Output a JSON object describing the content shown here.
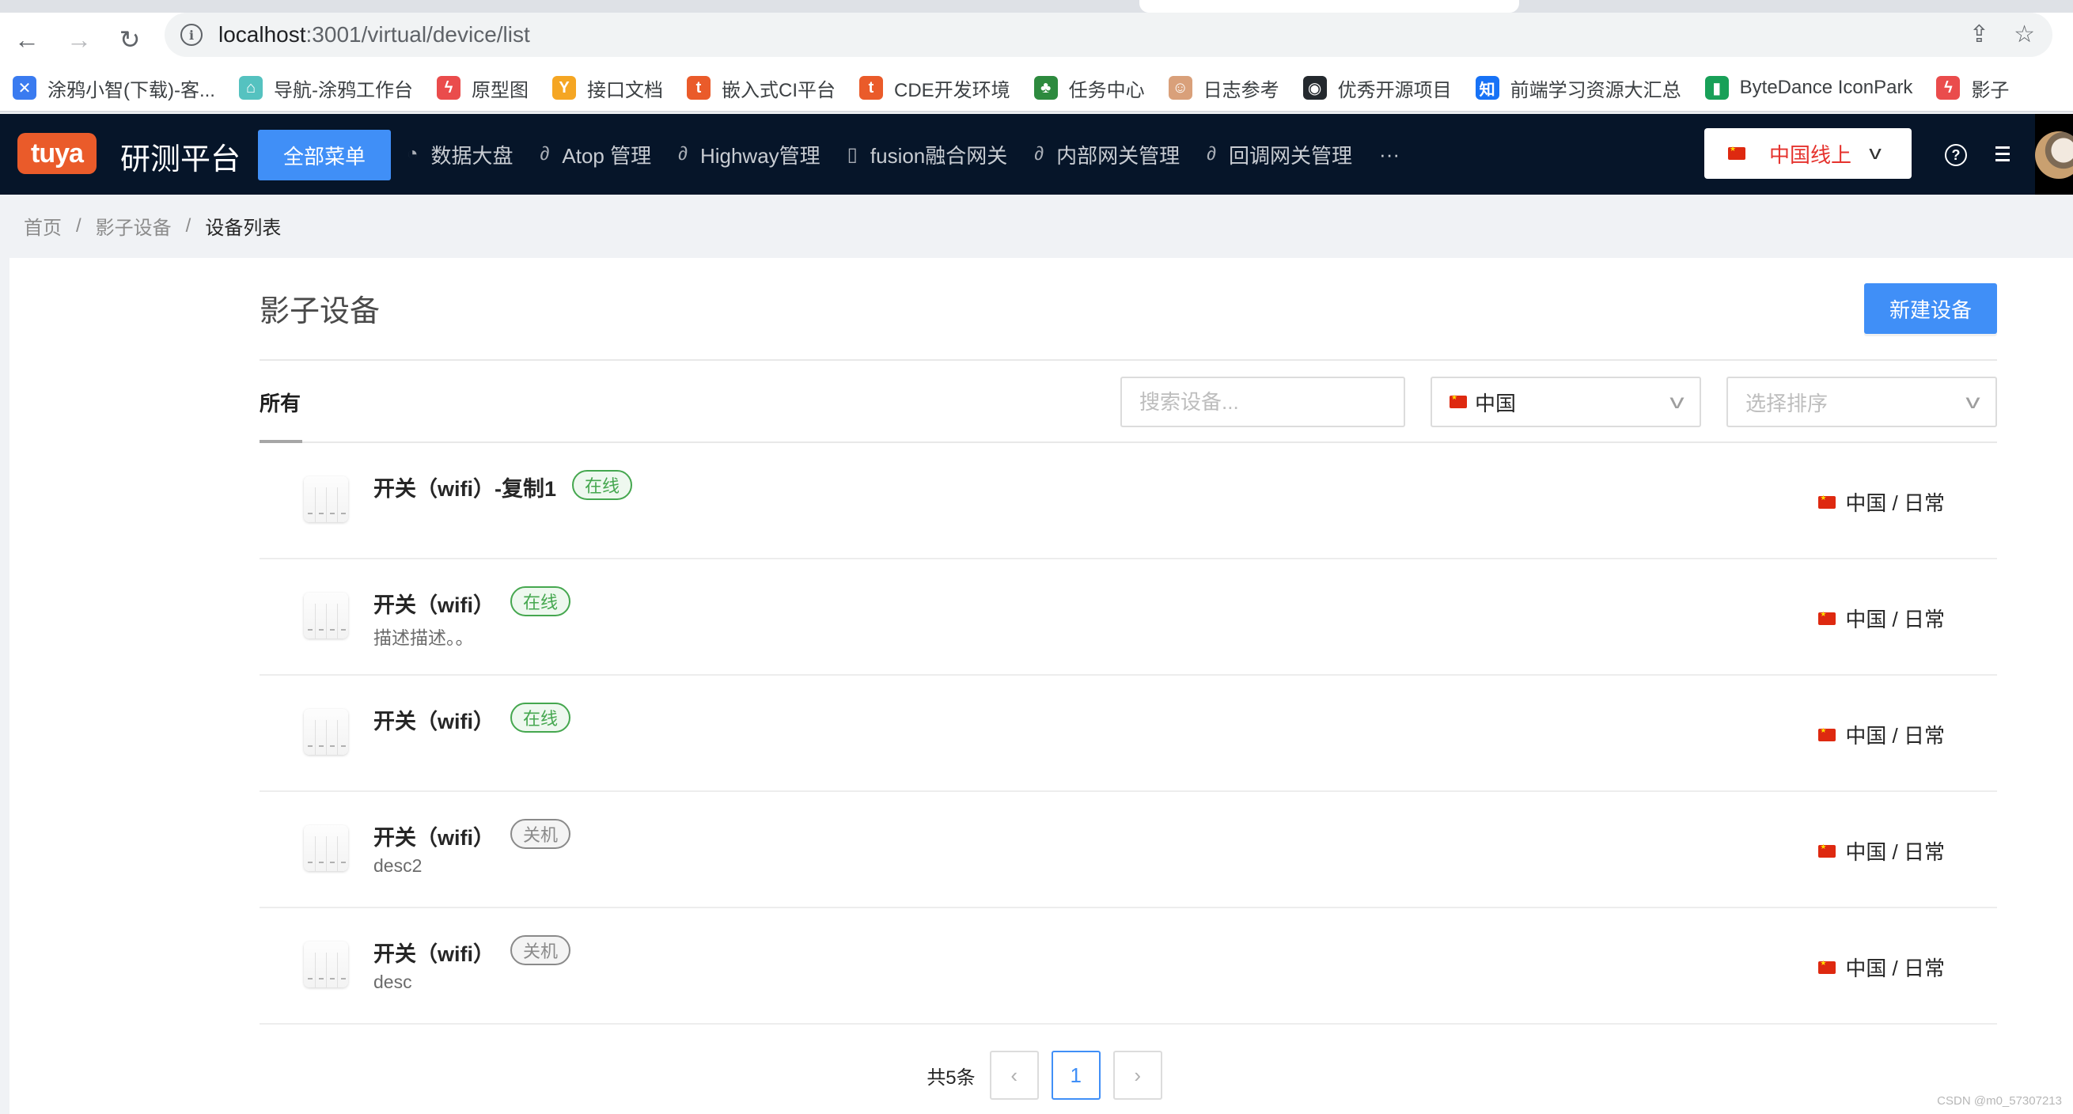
{
  "browser": {
    "url_host": "localhost",
    "url_path": ":3001/virtual/device/list",
    "bookmarks": [
      {
        "label": "涂鸦小智(下载)-客...",
        "icon": "tuya-xiaozhi-icon",
        "color": "#3a7bf0",
        "glyph": "✕"
      },
      {
        "label": "导航-涂鸦工作台",
        "icon": "home-icon",
        "color": "#55c2c0",
        "glyph": "⌂"
      },
      {
        "label": "原型图",
        "icon": "lightning-icon",
        "color": "#ea4c4c",
        "glyph": "ϟ"
      },
      {
        "label": "接口文档",
        "icon": "yapi-icon",
        "color": "#f5a623",
        "glyph": "Y"
      },
      {
        "label": "嵌入式CI平台",
        "icon": "tuya-t-icon",
        "color": "#ea5b2a",
        "glyph": "t"
      },
      {
        "label": "CDE开发环境",
        "icon": "tuya-t-icon",
        "color": "#ea5b2a",
        "glyph": "t"
      },
      {
        "label": "任务中心",
        "icon": "leaf-badge-icon",
        "color": "#2d8a3e",
        "glyph": "♣"
      },
      {
        "label": "日志参考",
        "icon": "jenkins-icon",
        "color": "#d9a07a",
        "glyph": "☺"
      },
      {
        "label": "优秀开源项目",
        "icon": "github-icon",
        "color": "#24292e",
        "glyph": "◉"
      },
      {
        "label": "前端学习资源大汇总",
        "icon": "zhihu-icon",
        "color": "#1772f6",
        "glyph": "知"
      },
      {
        "label": "ByteDance IconPark",
        "icon": "iconpark-icon",
        "color": "#18a058",
        "glyph": "▮"
      },
      {
        "label": "影子",
        "icon": "lightning-icon",
        "color": "#ea4c4c",
        "glyph": "ϟ"
      }
    ]
  },
  "appnav": {
    "logo": "tuya",
    "title": "研测平台",
    "all_menu": "全部菜单",
    "items": [
      {
        "label": "数据大盘",
        "icon": "pie-chart-icon",
        "glyph": "◔"
      },
      {
        "label": "Atop 管理",
        "icon": "link-icon",
        "glyph": "∂"
      },
      {
        "label": "Highway管理",
        "icon": "link-icon",
        "glyph": "∂"
      },
      {
        "label": "fusion融合网关",
        "icon": "document-icon",
        "glyph": "▯"
      },
      {
        "label": "内部网关管理",
        "icon": "link-icon",
        "glyph": "∂"
      },
      {
        "label": "回调网关管理",
        "icon": "link-icon",
        "glyph": "∂"
      }
    ],
    "more": "···",
    "region": "中国线上",
    "region_color": "#e5322d"
  },
  "breadcrumb": {
    "items": [
      "首页",
      "影子设备"
    ],
    "current": "设备列表",
    "separator": "/"
  },
  "page": {
    "title": "影子设备",
    "new_button": "新建设备",
    "tab_all": "所有",
    "search_placeholder": "搜索设备...",
    "region_value": "中国",
    "sort_placeholder": "选择排序"
  },
  "devices": [
    {
      "name": "开关（wifi）-复制1",
      "status": "在线",
      "status_type": "online",
      "desc": "",
      "region": "中国 / 日常"
    },
    {
      "name": "开关（wifi）",
      "status": "在线",
      "status_type": "online",
      "desc": "描述描述。。",
      "region": "中国 / 日常"
    },
    {
      "name": "开关（wifi）",
      "status": "在线",
      "status_type": "online",
      "desc": "",
      "region": "中国 / 日常"
    },
    {
      "name": "开关（wifi）",
      "status": "关机",
      "status_type": "off",
      "desc": "desc2",
      "region": "中国 / 日常"
    },
    {
      "name": "开关（wifi）",
      "status": "关机",
      "status_type": "off",
      "desc": "desc",
      "region": "中国 / 日常"
    }
  ],
  "pagination": {
    "total": "共5条",
    "current_page": "1",
    "prev": "‹",
    "next": "›"
  },
  "colors": {
    "primary": "#408ff7",
    "nav_bg": "#061529",
    "online": "#45a74f",
    "offline": "#8a8a8a"
  },
  "watermark": "CSDN @m0_57307213"
}
